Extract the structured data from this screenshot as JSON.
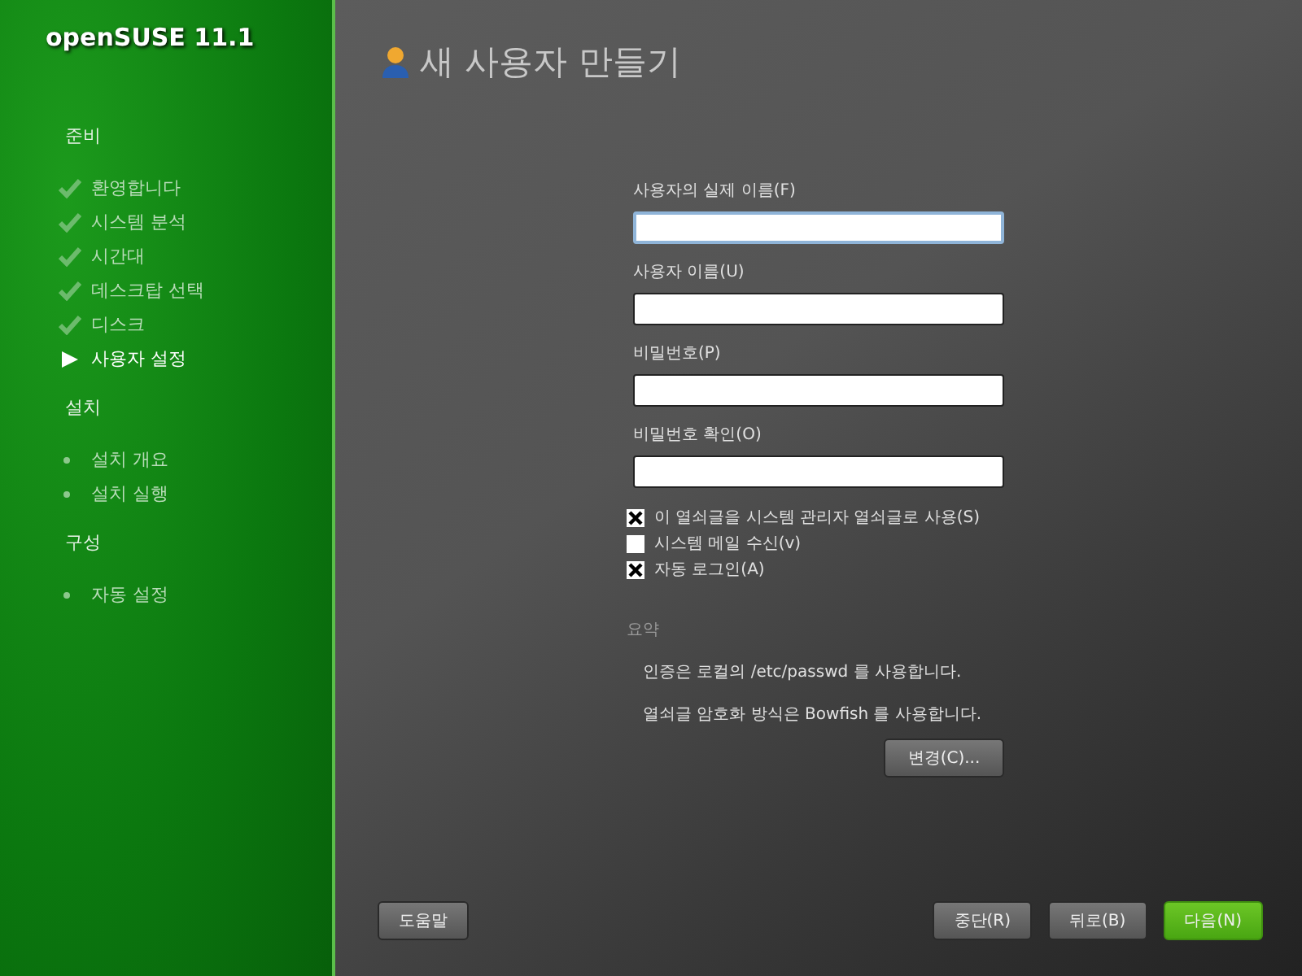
{
  "sidebar": {
    "product": "openSUSE 11.1",
    "sections": [
      {
        "title": "준비",
        "steps": [
          {
            "label": "환영합니다",
            "kind": "done"
          },
          {
            "label": "시스템 분석",
            "kind": "done"
          },
          {
            "label": "시간대",
            "kind": "done"
          },
          {
            "label": "데스크탑 선택",
            "kind": "done"
          },
          {
            "label": "디스크",
            "kind": "done"
          },
          {
            "label": "사용자 설정",
            "kind": "current"
          }
        ]
      },
      {
        "title": "설치",
        "steps": [
          {
            "label": "설치 개요",
            "kind": "pending"
          },
          {
            "label": "설치 실행",
            "kind": "pending"
          }
        ]
      },
      {
        "title": "구성",
        "steps": [
          {
            "label": "자동 설정",
            "kind": "pending"
          }
        ]
      }
    ]
  },
  "page": {
    "title": "새 사용자 만들기",
    "fields": [
      {
        "label": "사용자의 실제 이름(F)",
        "focused": true
      },
      {
        "label": "사용자 이름(U)",
        "focused": false
      },
      {
        "label": "비밀번호(P)",
        "focused": false
      },
      {
        "label": "비밀번호 확인(O)",
        "focused": false
      }
    ],
    "checkboxes": [
      {
        "label": "이 열쇠글을 시스템 관리자 열쇠글로 사용(S)",
        "checked": true
      },
      {
        "label": "시스템 메일 수신(v)",
        "checked": false
      },
      {
        "label": "자동 로그인(A)",
        "checked": true
      }
    ],
    "summary": {
      "title": "요약",
      "lines": [
        "인증은 로컬의 /etc/passwd 를 사용합니다.",
        "열쇠글 암호화 방식은 Bowfish 를 사용합니다."
      ],
      "button": "변경(C)..."
    }
  },
  "buttons": {
    "help": "도움말",
    "actions": [
      {
        "label": "중단(R)",
        "primary": false
      },
      {
        "label": "뒤로(B)",
        "primary": false
      },
      {
        "label": "다음(N)",
        "primary": true
      }
    ]
  }
}
